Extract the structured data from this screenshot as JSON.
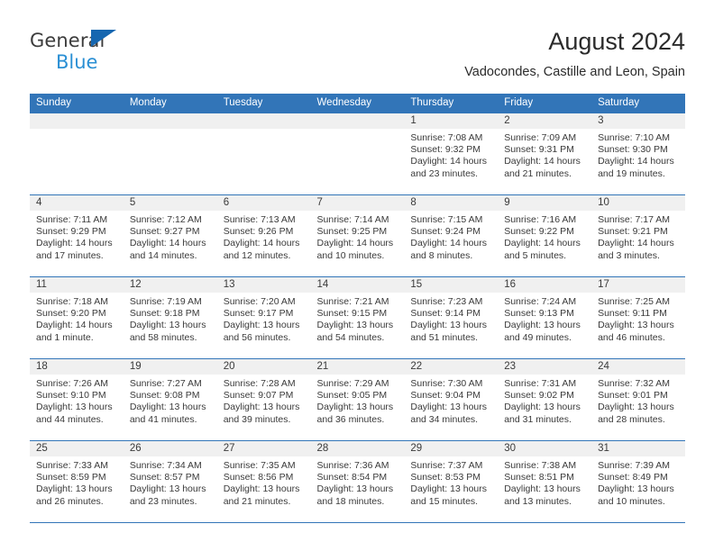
{
  "brand": {
    "name_top": "General",
    "name_bottom": "Blue",
    "triangle_color": "#1566b0",
    "bottom_color": "#2a8fd4"
  },
  "header": {
    "title": "August 2024",
    "subtitle": "Vadocondes, Castille and Leon, Spain",
    "header_bg": "#3275b8",
    "daynum_bg": "#f0f0f0"
  },
  "weekdays": [
    "Sunday",
    "Monday",
    "Tuesday",
    "Wednesday",
    "Thursday",
    "Friday",
    "Saturday"
  ],
  "weeks": [
    [
      {
        "day": "",
        "blank": true
      },
      {
        "day": "",
        "blank": true
      },
      {
        "day": "",
        "blank": true
      },
      {
        "day": "",
        "blank": true
      },
      {
        "day": "1",
        "sunrise": "Sunrise: 7:08 AM",
        "sunset": "Sunset: 9:32 PM",
        "daylight_l1": "Daylight: 14 hours",
        "daylight_l2": "and 23 minutes."
      },
      {
        "day": "2",
        "sunrise": "Sunrise: 7:09 AM",
        "sunset": "Sunset: 9:31 PM",
        "daylight_l1": "Daylight: 14 hours",
        "daylight_l2": "and 21 minutes."
      },
      {
        "day": "3",
        "sunrise": "Sunrise: 7:10 AM",
        "sunset": "Sunset: 9:30 PM",
        "daylight_l1": "Daylight: 14 hours",
        "daylight_l2": "and 19 minutes."
      }
    ],
    [
      {
        "day": "4",
        "sunrise": "Sunrise: 7:11 AM",
        "sunset": "Sunset: 9:29 PM",
        "daylight_l1": "Daylight: 14 hours",
        "daylight_l2": "and 17 minutes."
      },
      {
        "day": "5",
        "sunrise": "Sunrise: 7:12 AM",
        "sunset": "Sunset: 9:27 PM",
        "daylight_l1": "Daylight: 14 hours",
        "daylight_l2": "and 14 minutes."
      },
      {
        "day": "6",
        "sunrise": "Sunrise: 7:13 AM",
        "sunset": "Sunset: 9:26 PM",
        "daylight_l1": "Daylight: 14 hours",
        "daylight_l2": "and 12 minutes."
      },
      {
        "day": "7",
        "sunrise": "Sunrise: 7:14 AM",
        "sunset": "Sunset: 9:25 PM",
        "daylight_l1": "Daylight: 14 hours",
        "daylight_l2": "and 10 minutes."
      },
      {
        "day": "8",
        "sunrise": "Sunrise: 7:15 AM",
        "sunset": "Sunset: 9:24 PM",
        "daylight_l1": "Daylight: 14 hours",
        "daylight_l2": "and 8 minutes."
      },
      {
        "day": "9",
        "sunrise": "Sunrise: 7:16 AM",
        "sunset": "Sunset: 9:22 PM",
        "daylight_l1": "Daylight: 14 hours",
        "daylight_l2": "and 5 minutes."
      },
      {
        "day": "10",
        "sunrise": "Sunrise: 7:17 AM",
        "sunset": "Sunset: 9:21 PM",
        "daylight_l1": "Daylight: 14 hours",
        "daylight_l2": "and 3 minutes."
      }
    ],
    [
      {
        "day": "11",
        "sunrise": "Sunrise: 7:18 AM",
        "sunset": "Sunset: 9:20 PM",
        "daylight_l1": "Daylight: 14 hours",
        "daylight_l2": "and 1 minute."
      },
      {
        "day": "12",
        "sunrise": "Sunrise: 7:19 AM",
        "sunset": "Sunset: 9:18 PM",
        "daylight_l1": "Daylight: 13 hours",
        "daylight_l2": "and 58 minutes."
      },
      {
        "day": "13",
        "sunrise": "Sunrise: 7:20 AM",
        "sunset": "Sunset: 9:17 PM",
        "daylight_l1": "Daylight: 13 hours",
        "daylight_l2": "and 56 minutes."
      },
      {
        "day": "14",
        "sunrise": "Sunrise: 7:21 AM",
        "sunset": "Sunset: 9:15 PM",
        "daylight_l1": "Daylight: 13 hours",
        "daylight_l2": "and 54 minutes."
      },
      {
        "day": "15",
        "sunrise": "Sunrise: 7:23 AM",
        "sunset": "Sunset: 9:14 PM",
        "daylight_l1": "Daylight: 13 hours",
        "daylight_l2": "and 51 minutes."
      },
      {
        "day": "16",
        "sunrise": "Sunrise: 7:24 AM",
        "sunset": "Sunset: 9:13 PM",
        "daylight_l1": "Daylight: 13 hours",
        "daylight_l2": "and 49 minutes."
      },
      {
        "day": "17",
        "sunrise": "Sunrise: 7:25 AM",
        "sunset": "Sunset: 9:11 PM",
        "daylight_l1": "Daylight: 13 hours",
        "daylight_l2": "and 46 minutes."
      }
    ],
    [
      {
        "day": "18",
        "sunrise": "Sunrise: 7:26 AM",
        "sunset": "Sunset: 9:10 PM",
        "daylight_l1": "Daylight: 13 hours",
        "daylight_l2": "and 44 minutes."
      },
      {
        "day": "19",
        "sunrise": "Sunrise: 7:27 AM",
        "sunset": "Sunset: 9:08 PM",
        "daylight_l1": "Daylight: 13 hours",
        "daylight_l2": "and 41 minutes."
      },
      {
        "day": "20",
        "sunrise": "Sunrise: 7:28 AM",
        "sunset": "Sunset: 9:07 PM",
        "daylight_l1": "Daylight: 13 hours",
        "daylight_l2": "and 39 minutes."
      },
      {
        "day": "21",
        "sunrise": "Sunrise: 7:29 AM",
        "sunset": "Sunset: 9:05 PM",
        "daylight_l1": "Daylight: 13 hours",
        "daylight_l2": "and 36 minutes."
      },
      {
        "day": "22",
        "sunrise": "Sunrise: 7:30 AM",
        "sunset": "Sunset: 9:04 PM",
        "daylight_l1": "Daylight: 13 hours",
        "daylight_l2": "and 34 minutes."
      },
      {
        "day": "23",
        "sunrise": "Sunrise: 7:31 AM",
        "sunset": "Sunset: 9:02 PM",
        "daylight_l1": "Daylight: 13 hours",
        "daylight_l2": "and 31 minutes."
      },
      {
        "day": "24",
        "sunrise": "Sunrise: 7:32 AM",
        "sunset": "Sunset: 9:01 PM",
        "daylight_l1": "Daylight: 13 hours",
        "daylight_l2": "and 28 minutes."
      }
    ],
    [
      {
        "day": "25",
        "sunrise": "Sunrise: 7:33 AM",
        "sunset": "Sunset: 8:59 PM",
        "daylight_l1": "Daylight: 13 hours",
        "daylight_l2": "and 26 minutes."
      },
      {
        "day": "26",
        "sunrise": "Sunrise: 7:34 AM",
        "sunset": "Sunset: 8:57 PM",
        "daylight_l1": "Daylight: 13 hours",
        "daylight_l2": "and 23 minutes."
      },
      {
        "day": "27",
        "sunrise": "Sunrise: 7:35 AM",
        "sunset": "Sunset: 8:56 PM",
        "daylight_l1": "Daylight: 13 hours",
        "daylight_l2": "and 21 minutes."
      },
      {
        "day": "28",
        "sunrise": "Sunrise: 7:36 AM",
        "sunset": "Sunset: 8:54 PM",
        "daylight_l1": "Daylight: 13 hours",
        "daylight_l2": "and 18 minutes."
      },
      {
        "day": "29",
        "sunrise": "Sunrise: 7:37 AM",
        "sunset": "Sunset: 8:53 PM",
        "daylight_l1": "Daylight: 13 hours",
        "daylight_l2": "and 15 minutes."
      },
      {
        "day": "30",
        "sunrise": "Sunrise: 7:38 AM",
        "sunset": "Sunset: 8:51 PM",
        "daylight_l1": "Daylight: 13 hours",
        "daylight_l2": "and 13 minutes."
      },
      {
        "day": "31",
        "sunrise": "Sunrise: 7:39 AM",
        "sunset": "Sunset: 8:49 PM",
        "daylight_l1": "Daylight: 13 hours",
        "daylight_l2": "and 10 minutes."
      }
    ]
  ]
}
